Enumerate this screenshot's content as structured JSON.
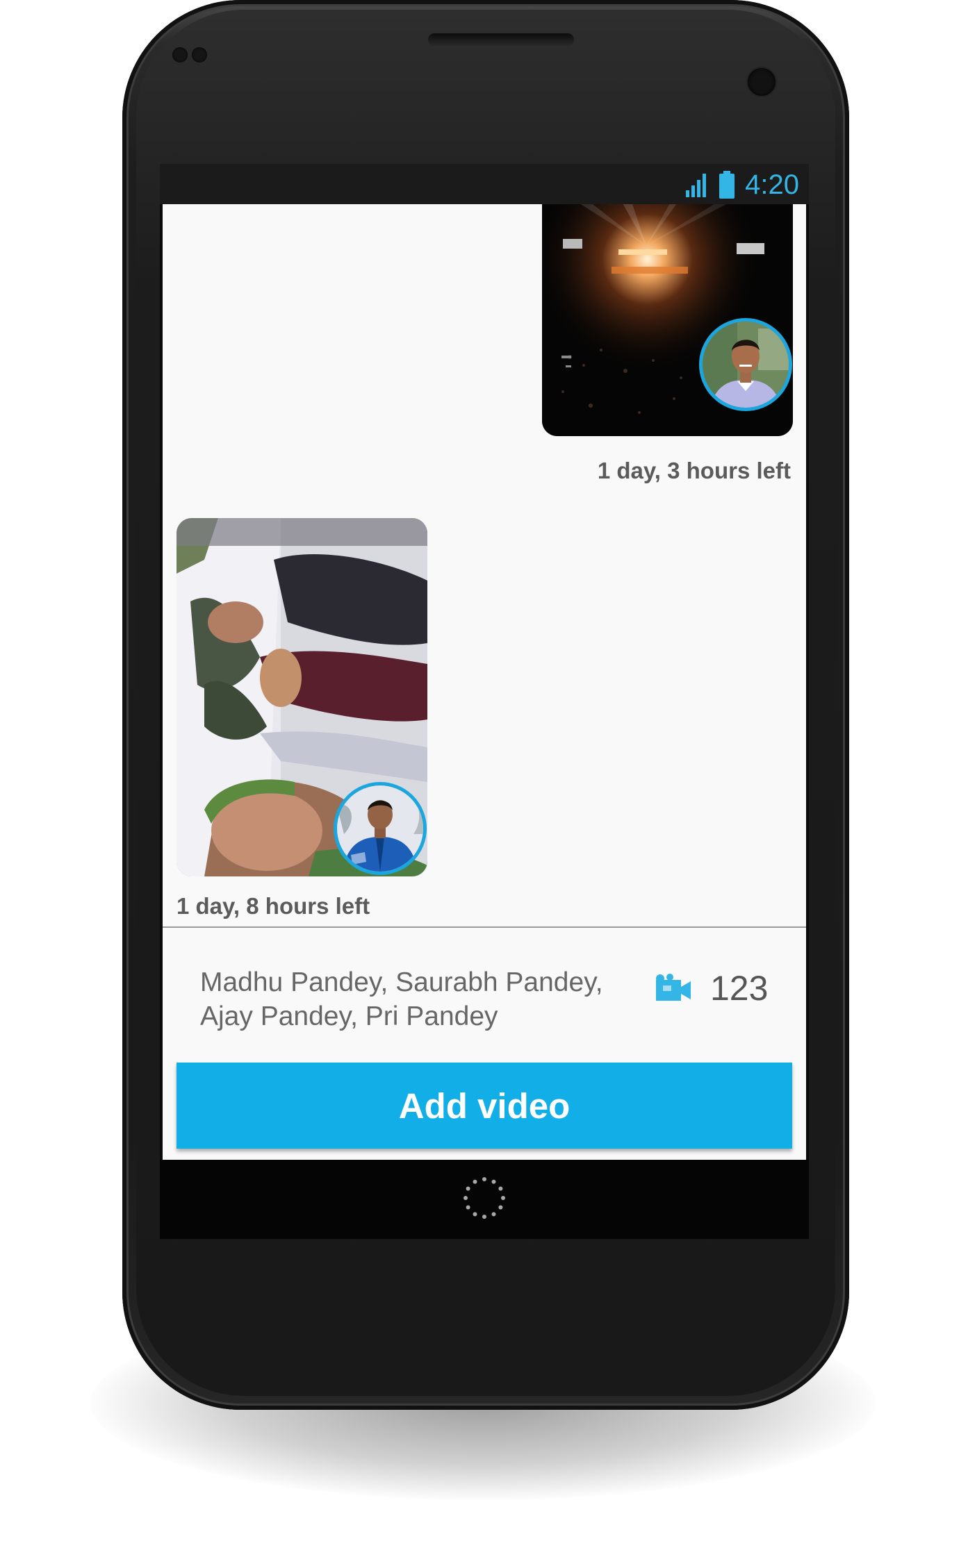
{
  "status_bar": {
    "time": "4:20",
    "icons": [
      "signal-icon",
      "battery-icon"
    ],
    "accent_color": "#33b5e5"
  },
  "clips": [
    {
      "thumbnail": "concert-stage-video-thumbnail",
      "sender_avatar": "avatar-man-striped-shirt",
      "time_left": "1 day, 3 hours left",
      "alignment": "right"
    },
    {
      "thumbnail": "group-selfie-video-thumbnail",
      "sender_avatar": "avatar-man-blue-jacket",
      "time_left": "1 day, 8 hours left",
      "alignment": "left"
    }
  ],
  "footer": {
    "participants": "Madhu Pandey, Saurabh Pandey, Ajay Pandey, Pri Pandey",
    "video_count": "123",
    "video_count_icon": "video-camera-icon",
    "add_button_label": "Add video",
    "accent_color": "#11aee8"
  },
  "nav": {
    "home_icon": "home-circle-icon"
  }
}
